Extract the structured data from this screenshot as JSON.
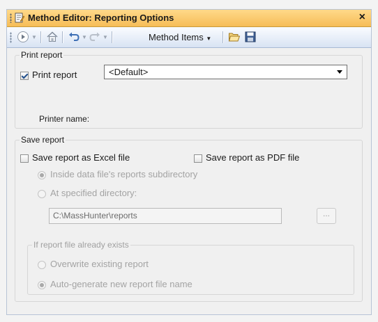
{
  "window": {
    "title": "Method Editor: Reporting Options",
    "close_glyph": "×"
  },
  "toolbar": {
    "method_items_label": "Method Items",
    "icons": [
      "run-icon",
      "home-icon",
      "undo-icon",
      "redo-icon",
      "open-icon",
      "save-icon"
    ]
  },
  "print_report": {
    "group_label": "Print report",
    "checkbox_label": "Print report",
    "checked": true,
    "printer_label": "Printer name:",
    "printer_value": "<Default>"
  },
  "save_report": {
    "group_label": "Save report",
    "excel_label": "Save report as Excel file",
    "excel_checked": false,
    "pdf_label": "Save report as PDF file",
    "pdf_checked": false,
    "location_options": [
      "Inside data file's reports subdirectory",
      "At specified directory:"
    ],
    "location_selected": 0,
    "directory_value": "C:\\MassHunter\\reports",
    "browse_label": "...",
    "exists_group_label": "If report file already exists",
    "exists_options": [
      "Overwrite existing report",
      "Auto-generate new report file name"
    ],
    "exists_selected": 1
  },
  "colors": {
    "title_bar": "#f6bd57",
    "toolbar": "#d8e3f3",
    "background": "#f0f0f0"
  }
}
